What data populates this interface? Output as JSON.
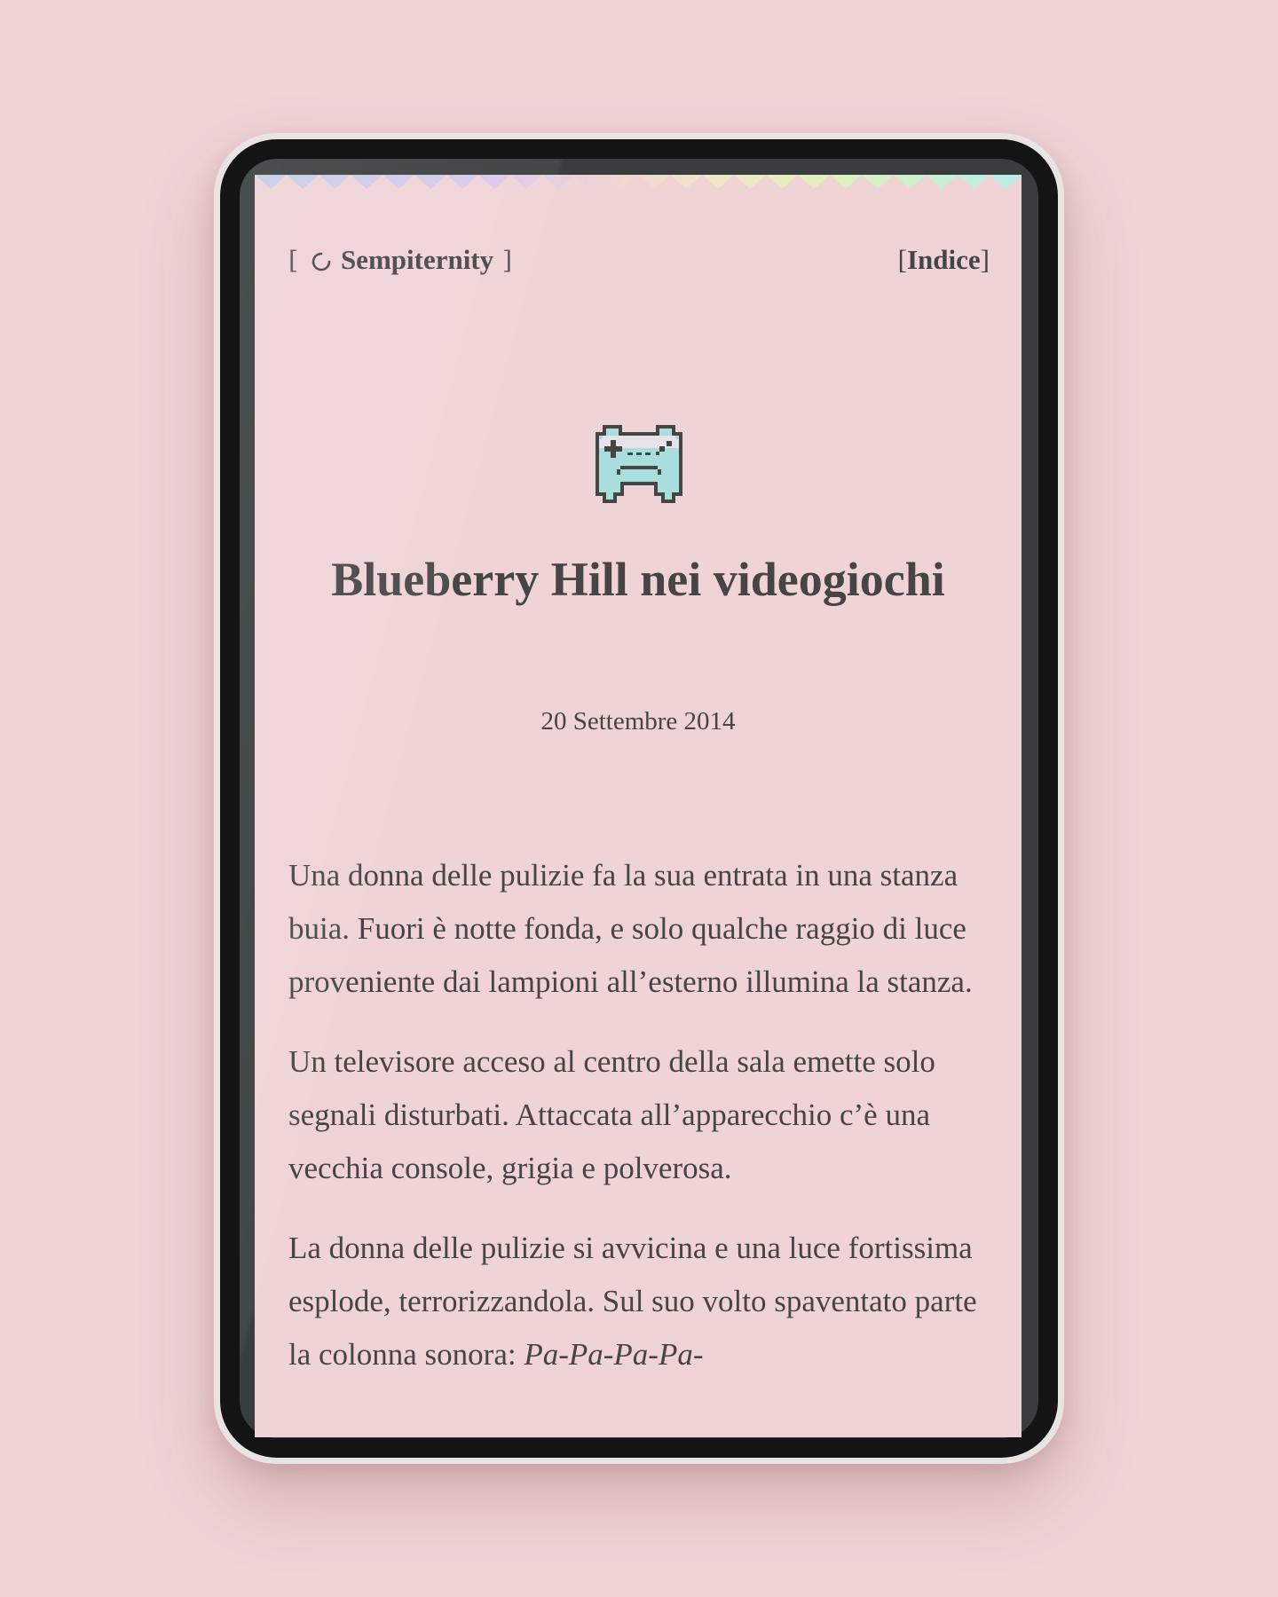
{
  "nav": {
    "brand_open": "[",
    "brand_name": "Sempiternity",
    "brand_close": "]",
    "index_open": "[",
    "index_label": "Indice",
    "index_close": "]"
  },
  "post": {
    "icon": "gamepad-icon",
    "title": "Blueberry Hill nei videogiochi",
    "date": "20 Settembre 2014",
    "paragraphs": [
      "Una donna delle pulizie fa la sua entrata in una stanza buia. Fuori è notte fonda, e solo qualche raggio di luce proveniente dai lampioni all’esterno illumina la stanza.",
      "Un televisore acceso al centro della sala emette solo segnali disturbati. Attaccata all’apparecchio c’è una vecchia console, grigia e polverosa."
    ],
    "paragraph3_text": "La donna delle pulizie si avvicina e una luce fortissima esplode, terrorizzandola. Sul suo volto spaventato parte la colonna sonora: ",
    "paragraph3_emphasis": "Pa-Pa-Pa-Pa-"
  },
  "colors": {
    "background": "#efd3d5",
    "text": "#474444",
    "bezel": "#141414",
    "controller_fill": "#a9dedd"
  }
}
